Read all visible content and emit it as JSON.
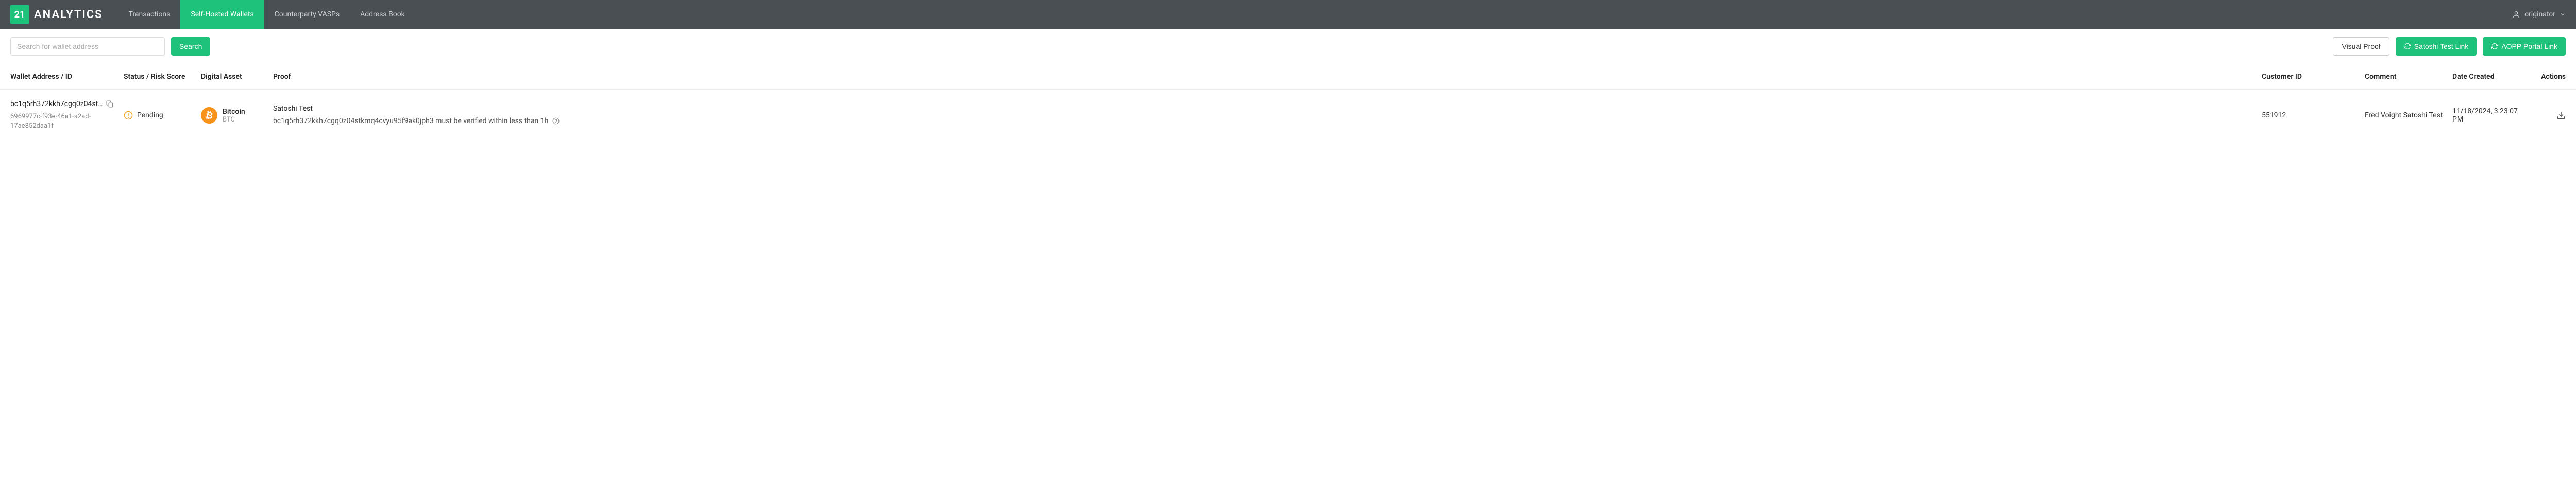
{
  "brand": {
    "square": "21",
    "name": "ANALYTICS"
  },
  "nav": {
    "items": [
      {
        "label": "Transactions",
        "active": false
      },
      {
        "label": "Self-Hosted Wallets",
        "active": true
      },
      {
        "label": "Counterparty VASPs",
        "active": false
      },
      {
        "label": "Address Book",
        "active": false
      }
    ]
  },
  "user": {
    "name": "originator"
  },
  "toolbar": {
    "search_placeholder": "Search for wallet address",
    "search_btn": "Search",
    "visual_proof": "Visual Proof",
    "satoshi_link": "Satoshi Test Link",
    "aopp_link": "AOPP Portal Link"
  },
  "table": {
    "headers": {
      "addr": "Wallet Address / ID",
      "status": "Status / Risk Score",
      "asset": "Digital Asset",
      "proof": "Proof",
      "cust": "Customer ID",
      "comment": "Comment",
      "date": "Date Created",
      "actions": "Actions"
    },
    "rows": [
      {
        "addr_short": "bc1q5rh372kkh7cgq0z04stk...",
        "addr_id": "6969977c-f93e-46a1-a2ad-17ae852daa1f",
        "status": "Pending",
        "asset_name": "Bitcoin",
        "asset_ticker": "BTC",
        "proof_title": "Satoshi Test",
        "proof_body": "bc1q5rh372kkh7cgq0z04stkmq4cvyu95f9ak0jph3 must be verified within less than 1h",
        "customer_id": "551912",
        "comment": "Fred Voight Satoshi Test",
        "date": "11/18/2024, 3:23:07 PM"
      }
    ]
  },
  "colors": {
    "accent": "#1fc27a",
    "topbar": "#4a4f54",
    "btc": "#f7931a",
    "warn": "#f5a623"
  }
}
